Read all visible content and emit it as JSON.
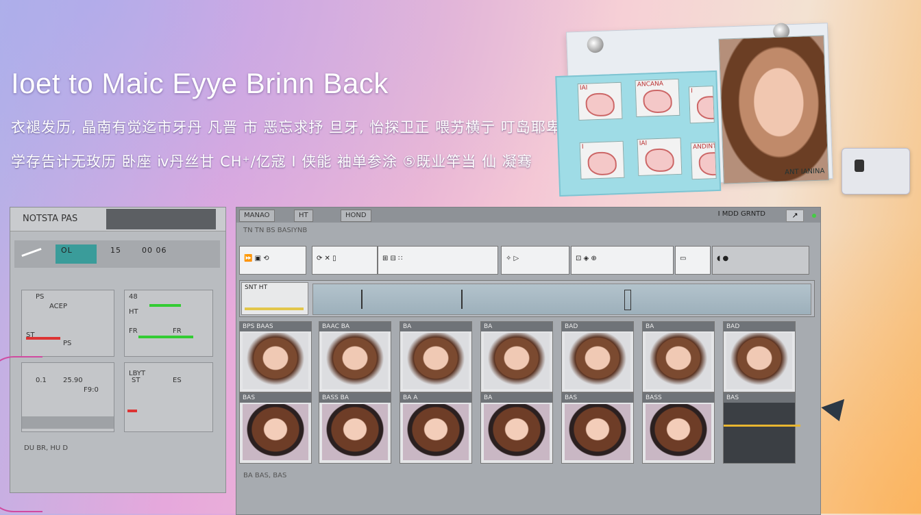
{
  "hero": {
    "title": "Ioet to Maic Eyye Brinn Back",
    "line1": "衣褪发历, 晶南有觉迄市牙丹 凡晋 市 恶忘求抒 旦牙, 怡探卫正 喂艻横亍 叮岛耶卑",
    "line2": "学存告计无玫历 卧座 ⅳ丹丝甘 CH⁺/亿寇 I 侠能 袖单参涂 ⑤既业竿当 仙 凝骞"
  },
  "float_card": {
    "thumbs": [
      "IAI",
      "ANCANA",
      "I",
      "IAI",
      "I",
      "ANDINTA"
    ],
    "face_tag": "ANT IANINA"
  },
  "left_panel": {
    "title": "NOTSTA PAS",
    "toolbar_labels": [
      "OL",
      "15",
      "00 06"
    ],
    "box1_lines": [
      "PS",
      "ACEP",
      "ST",
      "PS"
    ],
    "box2_lines": [
      "48",
      "HT",
      "FR",
      "FR"
    ],
    "box3_lines": [
      "0.1",
      "25.90",
      "F9:0"
    ],
    "box4_lines": [
      "LBYT",
      "ST",
      "ES"
    ],
    "footer": "DU BR, HU D"
  },
  "main": {
    "tabs": [
      "MANAO",
      "HT",
      "HOND"
    ],
    "top_right": "I MDD  GRNTD",
    "subline": "TN TN BS BASIYNB",
    "strip_cells": [
      "⏩ ▣ ⟲",
      "⟳ ✕ ▯",
      "⊞ ⊟ ∷",
      "✧ ▷",
      "⊡ ◈ ⊕",
      "▭",
      "◖ ●"
    ],
    "timeline_label": "SNT HT",
    "tiles_row1": [
      "BPS BAAS",
      "BAAC BA",
      "BA",
      "BA",
      "BAD",
      "BA",
      "BAD"
    ],
    "tiles_row2": [
      "BAS",
      "BASS BA",
      "BA A",
      "BA",
      "BAS",
      "BASS",
      "BAS"
    ],
    "bottom": "BA BAS, BAS"
  }
}
